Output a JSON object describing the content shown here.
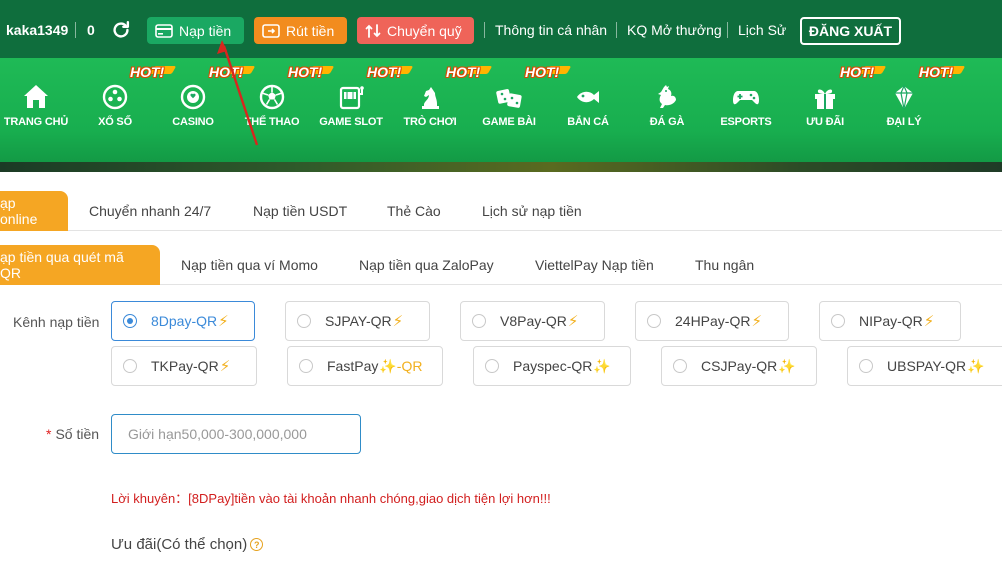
{
  "topbar": {
    "username": "kaka1349",
    "balance": "0",
    "deposit_button": "Nạp tiền",
    "withdraw_button": "Rút tiền",
    "transfer_button": "Chuyển quỹ",
    "links": [
      "Thông tin cá nhân",
      "KQ Mở thưởng",
      "Lịch Sử"
    ],
    "logout_button": "ĐĂNG XUẤT"
  },
  "nav": {
    "items": [
      {
        "label": "TRANG CHỦ",
        "icon": "home-icon",
        "hot": false
      },
      {
        "label": "XỔ SỐ",
        "icon": "lottery-icon",
        "hot": true
      },
      {
        "label": "CASINO",
        "icon": "casino-chip-icon",
        "hot": true
      },
      {
        "label": "THỂ THAO",
        "icon": "soccer-ball-icon",
        "hot": true
      },
      {
        "label": "GAME SLOT",
        "icon": "slot-machine-icon",
        "hot": true
      },
      {
        "label": "TRÒ CHƠI",
        "icon": "chess-knight-icon",
        "hot": true
      },
      {
        "label": "GAME BÀI",
        "icon": "dice-icon",
        "hot": true
      },
      {
        "label": "BẮN CÁ",
        "icon": "fish-icon",
        "hot": false
      },
      {
        "label": "ĐÁ GÀ",
        "icon": "rooster-icon",
        "hot": false
      },
      {
        "label": "ESPORTS",
        "icon": "gamepad-icon",
        "hot": false
      },
      {
        "label": "ƯU ĐÃI",
        "icon": "gift-icon",
        "hot": true
      },
      {
        "label": "ĐẠI LÝ",
        "icon": "diamond-agent-icon",
        "hot": true
      }
    ],
    "hot_label": "HOT!"
  },
  "tabs_primary": [
    "ạp online",
    "Chuyển nhanh 24/7",
    "Nạp tiền USDT",
    "Thẻ Cào",
    "Lịch sử nạp tiền"
  ],
  "tabs_secondary": [
    "ạp tiền qua quét mã QR",
    "Nạp tiền qua ví Momo",
    "Nạp tiền qua ZaloPay",
    "ViettelPay Nạp tiền",
    "Thu ngân"
  ],
  "form": {
    "channel_label": "Kênh nạp tiền",
    "channels": [
      {
        "name": "8Dpay-QR",
        "suffix": "⚡",
        "selected": true
      },
      {
        "name": "SJPAY-QR",
        "suffix": "⚡",
        "selected": false
      },
      {
        "name": "V8Pay-QR",
        "suffix": "⚡",
        "selected": false
      },
      {
        "name": "24HPay-QR",
        "suffix": "⚡",
        "selected": false
      },
      {
        "name": "NIPay-QR",
        "suffix": "⚡",
        "selected": false
      },
      {
        "name": "TKPay-QR",
        "suffix": "⚡",
        "selected": false
      },
      {
        "name": "FastPay",
        "suffix": "✨-QR",
        "selected": false
      },
      {
        "name": "Payspec-QR",
        "suffix": "✨",
        "selected": false
      },
      {
        "name": "CSJPay-QR",
        "suffix": "✨",
        "selected": false
      },
      {
        "name": "UBSPAY-QR",
        "suffix": "✨",
        "selected": false
      }
    ],
    "amount_label": "Số tiền",
    "amount_required_mark": "*",
    "amount_placeholder": "Giới hạn50,000-300,000,000",
    "hint": "Lời khuyên：[8DPay]tiền vào tài khoản nhanh chóng,giao dịch tiện lợi hơn!!!",
    "promo_label": "Ưu đãi(Có thể chọn)",
    "promo_help": "?"
  },
  "colors": {
    "topbar_bg": "#0f6e3d",
    "nav_bg": "#1fba56",
    "active_tab": "#f5a623",
    "selected_channel": "#3b8ad9",
    "hint_text": "#d21f1f"
  }
}
